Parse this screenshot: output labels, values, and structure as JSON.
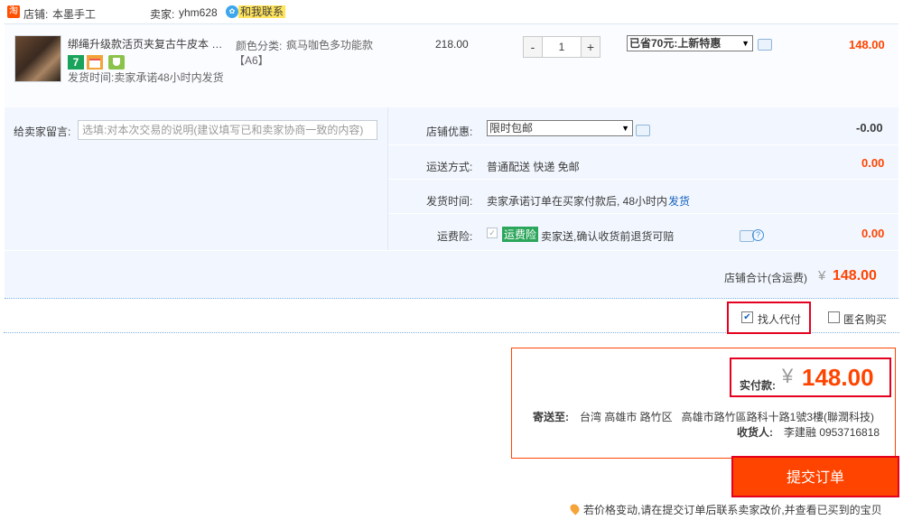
{
  "shop": {
    "logo_char": "淘",
    "label": "店铺:",
    "name": "本墨手工",
    "seller_label": "卖家:",
    "seller_name": "yhm628",
    "contact_label": "和我联系"
  },
  "item": {
    "title": "绑绳升级款活页夹复古牛皮本 旅...",
    "badges": [
      "7",
      "",
      ""
    ],
    "ship_time": "发货时间:卖家承诺48小时内发货",
    "sku_label": "颜色分类:",
    "sku_value": "疯马咖色多功能款【A6】",
    "price": "218.00",
    "qty": "1",
    "qty_minus": "-",
    "qty_plus": "+",
    "promo_selected": "已省70元:上新特惠",
    "subtotal": "148.00"
  },
  "order": {
    "message_label": "给卖家留言:",
    "message_placeholder": "选填:对本次交易的说明(建议填写已和卖家协商一致的内容)",
    "discount_label": "店铺优惠:",
    "discount_selected": "限时包邮",
    "discount_value": "-0.00",
    "shipping_label": "运送方式:",
    "shipping_value": "普通配送 快递 免邮",
    "shipping_fee": "0.00",
    "delivery_label": "发货时间:",
    "delivery_text": "卖家承诺订单在买家付款后, 48小时内",
    "delivery_link": "发货",
    "insurance_label": "运费险:",
    "insurance_tag": "运费险",
    "insurance_text": "卖家送,确认收货前退货可赔",
    "insurance_fee": "0.00",
    "shop_total_label": "店铺合计(含运费)",
    "currency": "¥",
    "shop_total": "148.00"
  },
  "options": {
    "proxy_pay": "找人代付",
    "proxy_pay_checked": true,
    "anonymous": "匿名购买",
    "anonymous_checked": false
  },
  "summary": {
    "paid_label": "实付款:",
    "currency": "¥",
    "paid_amount": "148.00",
    "ship_to_label": "寄送至:",
    "address": "台湾 高雄市 路竹区   高雄市路竹區路科十路1號3樓(聯潤科技)",
    "receiver_label": "收货人:",
    "receiver": "李建融 0953716818"
  },
  "submit_label": "提交订单",
  "footer_note": "若价格变动,请在提交订单后联系卖家改价,并查看已买到的宝贝",
  "colors": {
    "accent": "#ff4400",
    "highlight_red": "#e4001e",
    "panel_bg": "#f2f7ff",
    "link": "#1560bd"
  }
}
